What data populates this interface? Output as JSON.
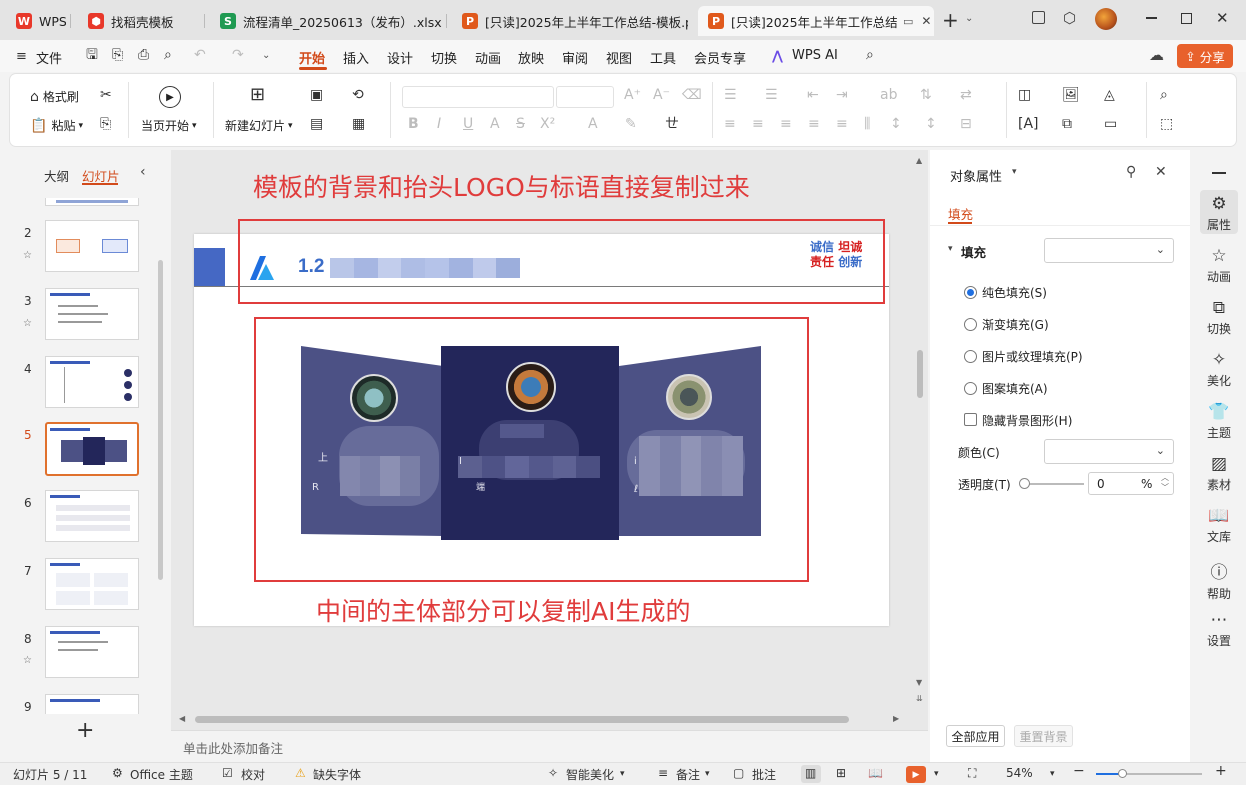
{
  "titlebar": {
    "tabs": [
      {
        "label": "WPS",
        "icon": "wps-logo-icon"
      },
      {
        "label": "找稻壳模板",
        "icon": "docer-icon"
      },
      {
        "label": "流程清单_20250613（发布）.xlsx",
        "icon": "spreadsheet-icon"
      },
      {
        "label": "[只读]2025年上半年工作总结-模板.p",
        "icon": "presentation-icon"
      },
      {
        "label": "[只读]2025年上半年工作总结",
        "icon": "presentation-icon"
      }
    ],
    "new_tab": "+"
  },
  "menubar": {
    "file": "文件",
    "items": [
      "开始",
      "插入",
      "设计",
      "切换",
      "动画",
      "放映",
      "审阅",
      "视图",
      "工具",
      "会员专享"
    ],
    "wps_ai": "WPS AI",
    "share": "分享"
  },
  "ribbon": {
    "format_painter": "格式刷",
    "paste": "粘贴",
    "play_from_current": "当页开始",
    "new_slide": "新建幻灯片"
  },
  "left_panel": {
    "tab_outline": "大纲",
    "tab_slides": "幻灯片",
    "slide_numbers": [
      "2",
      "3",
      "4",
      "5",
      "6",
      "7",
      "8",
      "9"
    ],
    "add": "+"
  },
  "slide": {
    "header_number": "1.2",
    "slogan_line1_a": "诚信",
    "slogan_line1_b": "坦诚",
    "slogan_line2_a": "责任",
    "slogan_line2_b": "创新",
    "annotation_top": "模板的背景和抬头LOGO与标语直接复制过来",
    "annotation_bottom": "中间的主体部分可以复制AI生成的",
    "card_left_fragments": [
      "上",
      "R"
    ],
    "card_center_fragments": [
      "I",
      "端"
    ],
    "card_right_fragments": [
      "i",
      "ℓ"
    ]
  },
  "notes_placeholder": "单击此处添加备注",
  "props": {
    "title": "对象属性",
    "tab_fill": "填充",
    "section_fill": "填充",
    "options": [
      "纯色填充(S)",
      "渐变填充(G)",
      "图片或纹理填充(P)",
      "图案填充(A)"
    ],
    "selected_option": "纯色填充(S)",
    "hide_bg": "隐藏背景图形(H)",
    "color_label": "颜色(C)",
    "transparency_label": "透明度(T)",
    "transparency_value": "0",
    "transparency_unit": "%",
    "apply_all": "全部应用",
    "reset_bg": "重置背景"
  },
  "rightbar": {
    "items": [
      "属性",
      "动画",
      "切换",
      "美化",
      "主题",
      "素材",
      "文库",
      "帮助",
      "设置"
    ]
  },
  "statusbar": {
    "slide_pos": "幻灯片 5 / 11",
    "theme": "Office 主题",
    "proofread": "校对",
    "missing_font": "缺失字体",
    "beautify": "智能美化",
    "notes": "备注",
    "comments": "批注",
    "zoom": "54%"
  },
  "colors": {
    "accent_orange": "#d24a1a",
    "annotation_red": "#e03c3c",
    "card_dark": "#23265a",
    "card_side": "#4c5185",
    "slogan_blue": "#3a6cc8",
    "slogan_red": "#d62020"
  }
}
